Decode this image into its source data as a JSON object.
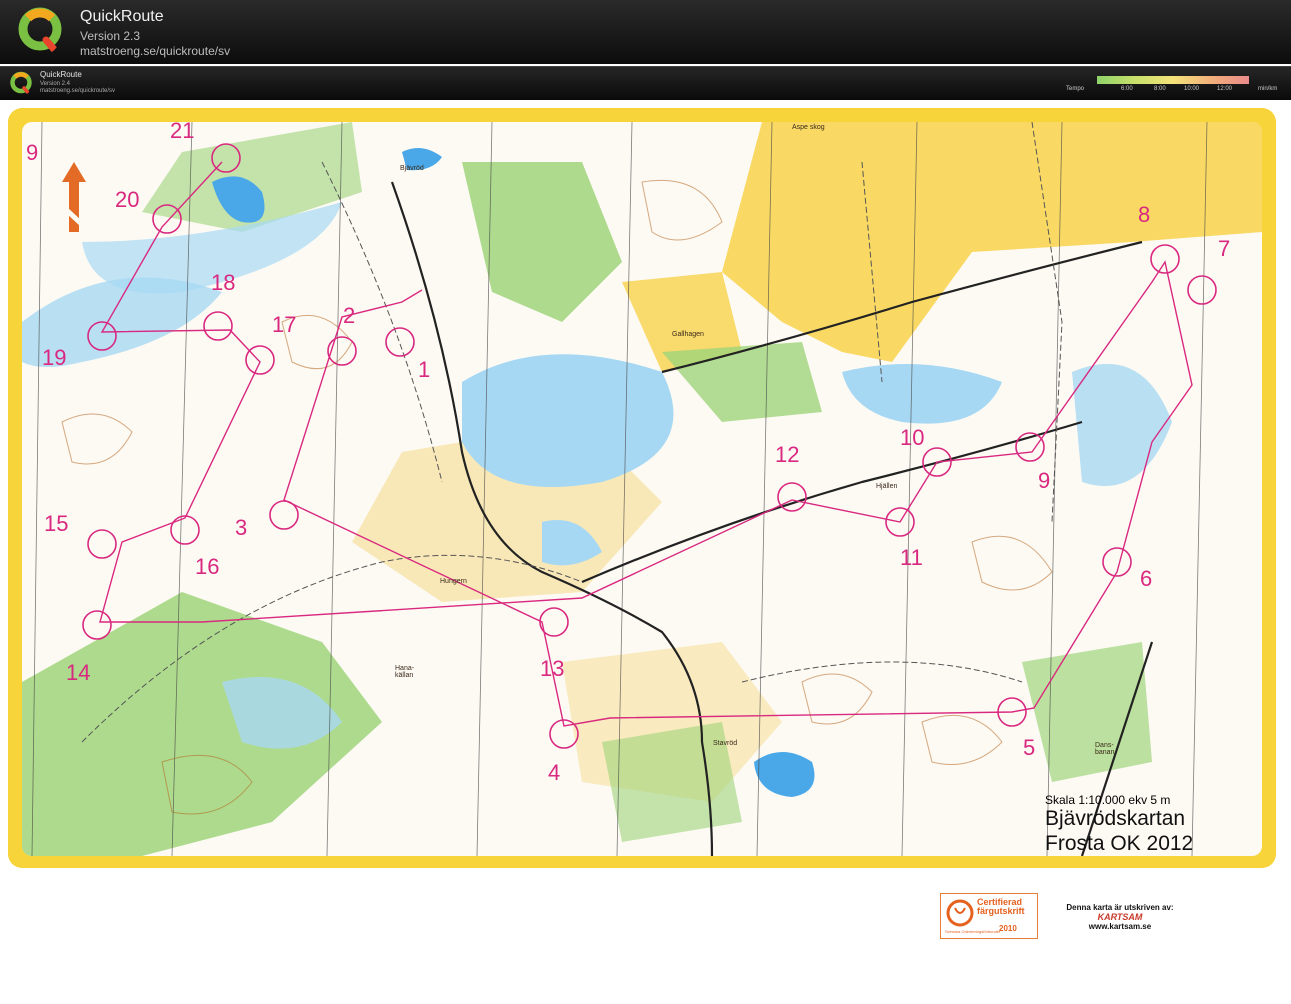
{
  "header": {
    "app_name": "QuickRoute",
    "version": "Version 2.3",
    "url": "matstroeng.se/quickroute/sv"
  },
  "subheader": {
    "app_name": "QuickRoute",
    "version": "Version 2.4",
    "url": "matstroeng.se/quickroute/sv"
  },
  "tempo": {
    "label": "Tempo",
    "ticks": [
      "6:00",
      "8:00",
      "10:00",
      "12:00"
    ],
    "unit": "min/km"
  },
  "map": {
    "title_line1": "Bjävrödskartan",
    "title_line2": "Frosta OK 2012",
    "scale": "Skala 1:10.000 ekv 5 m",
    "north_letter": "N",
    "controls": [
      {
        "label": "1"
      },
      {
        "label": "2"
      },
      {
        "label": "3"
      },
      {
        "label": "4"
      },
      {
        "label": "5"
      },
      {
        "label": "6"
      },
      {
        "label": "7"
      },
      {
        "label": "8"
      },
      {
        "label": "9"
      },
      {
        "label": "10"
      },
      {
        "label": "11"
      },
      {
        "label": "12"
      },
      {
        "label": "13"
      },
      {
        "label": "14"
      },
      {
        "label": "15"
      },
      {
        "label": "16"
      },
      {
        "label": "17"
      },
      {
        "label": "18"
      },
      {
        "label": "19"
      },
      {
        "label": "20"
      },
      {
        "label": "21"
      },
      {
        "label": "9"
      }
    ],
    "place_names": [
      "Bjävröd",
      "Gallhagen",
      "Hjällen",
      "Hungern",
      "Hana-källan",
      "Stavröd",
      "Dans-banan",
      "Aspe skog"
    ]
  },
  "footer": {
    "cert_title": "Certifierad färgutskrift",
    "cert_year": "2010",
    "cert_org": "Svenska Orienteringsförbundet",
    "printed_by": "Denna karta är utskriven av:",
    "printer_logo": "KARTSAM",
    "printer_url": "www.kartsam.se"
  },
  "colors": {
    "course": "#d9287f",
    "map_border": "#f6d43a",
    "water": "#4aa8e8"
  }
}
